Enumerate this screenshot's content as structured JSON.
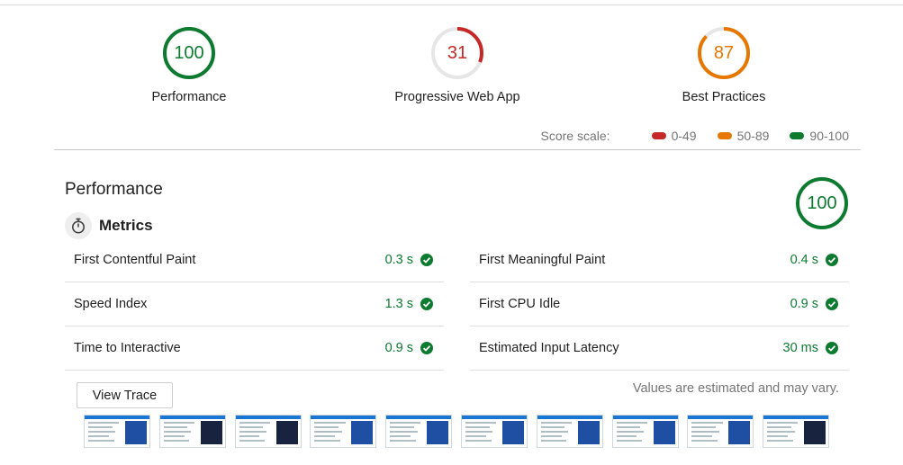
{
  "gauges": [
    {
      "score": "100",
      "label": "Performance",
      "color": "#0c7a2f",
      "fraction": 1.0
    },
    {
      "score": "31",
      "label": "Progressive Web App",
      "color": "#c62828",
      "fraction": 0.31
    },
    {
      "score": "87",
      "label": "Best Practices",
      "color": "#e67700",
      "fraction": 0.87
    }
  ],
  "scale": {
    "title": "Score scale:",
    "items": [
      {
        "label": "0-49",
        "color": "#c62828"
      },
      {
        "label": "50-89",
        "color": "#e67700"
      },
      {
        "label": "90-100",
        "color": "#0c7a2f"
      }
    ]
  },
  "category": {
    "title": "Performance",
    "score": "100",
    "score_color": "#0c7a2f",
    "metrics_title": "Metrics",
    "metrics_icon": "stopwatch-icon"
  },
  "metrics_left": [
    {
      "name": "First Contentful Paint",
      "value": "0.3 s"
    },
    {
      "name": "Speed Index",
      "value": "1.3 s"
    },
    {
      "name": "Time to Interactive",
      "value": "0.9 s"
    }
  ],
  "metrics_right": [
    {
      "name": "First Meaningful Paint",
      "value": "0.4 s"
    },
    {
      "name": "First CPU Idle",
      "value": "0.9 s"
    },
    {
      "name": "Estimated Input Latency",
      "value": "30 ms"
    }
  ],
  "pass_color": "#0c7a2f",
  "trace_button": "View Trace",
  "note": "Values are estimated and may vary.",
  "filmstrip_count": 10
}
